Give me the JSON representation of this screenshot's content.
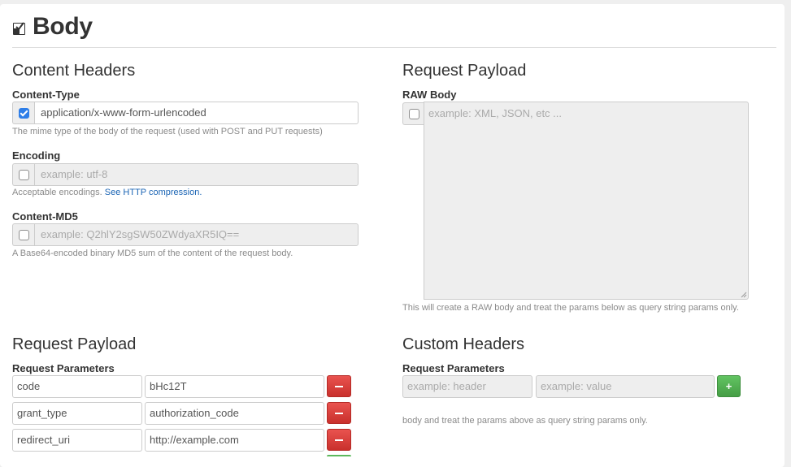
{
  "page": {
    "title": "Body"
  },
  "content_headers": {
    "heading": "Content Headers",
    "content_type": {
      "label": "Content-Type",
      "checked": true,
      "value": "application/x-www-form-urlencoded",
      "help": "The mime type of the body of the request (used with POST and PUT requests)"
    },
    "encoding": {
      "label": "Encoding",
      "checked": false,
      "placeholder": "example: utf-8",
      "help": "Acceptable encodings.",
      "help_link": "See HTTP compression."
    },
    "content_md5": {
      "label": "Content-MD5",
      "checked": false,
      "placeholder": "example: Q2hlY2sgSW50ZWdyaXR5IQ==",
      "help": "A Base64-encoded binary MD5 sum of the content of the request body."
    }
  },
  "raw_payload": {
    "heading": "Request Payload",
    "label": "RAW Body",
    "checked": false,
    "placeholder": "example: XML, JSON, etc ...",
    "help": "This will create a RAW body and treat the params below as query string params only."
  },
  "request_payload": {
    "heading": "Request Payload",
    "label": "Request Parameters",
    "params": [
      {
        "name": "code",
        "value": "bHc12T"
      },
      {
        "name": "grant_type",
        "value": "authorization_code"
      },
      {
        "name": "redirect_uri",
        "value": "http://example.com"
      }
    ],
    "remove_symbol": "−"
  },
  "custom_headers": {
    "heading": "Custom Headers",
    "label": "Request Parameters",
    "header_placeholder": "example: header",
    "value_placeholder": "example: value",
    "add_symbol": "+",
    "help": "body and treat the params above as query string params only."
  },
  "colors": {
    "checkbox_checked": "#2e7ee8",
    "remove_button": "#d9534f",
    "add_button": "#5cb85c",
    "link": "#1a64b4"
  },
  "icons": {
    "title": "checkbox-icon",
    "remove": "minus-icon",
    "add": "plus-icon"
  }
}
